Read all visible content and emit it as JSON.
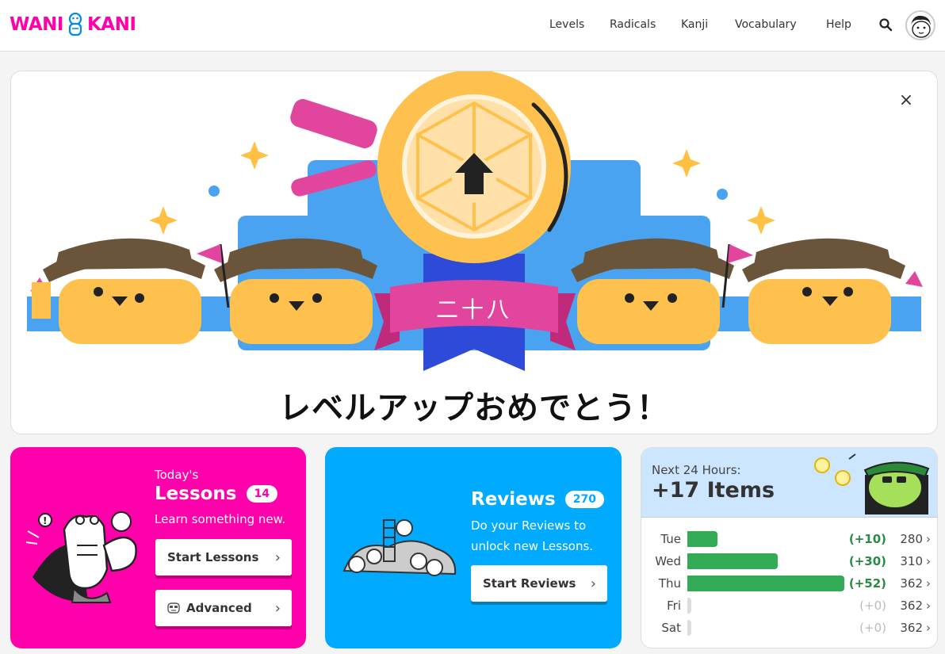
{
  "header": {
    "logo_left": "WANI",
    "logo_right": "KANI",
    "nav": [
      "Levels",
      "Radicals",
      "Kanji",
      "Vocabulary",
      "Help"
    ]
  },
  "celebration": {
    "level_kanji": "二十八",
    "message": "レベルアップおめでとう！",
    "close": "×"
  },
  "lessons": {
    "kicker": "Today's",
    "title": "Lessons",
    "count": "14",
    "subtitle": "Learn something new.",
    "start_button": "Start Lessons",
    "advanced_button": "Advanced"
  },
  "reviews": {
    "title": "Reviews",
    "count": "270",
    "subtitle": "Do your Reviews to unlock new Lessons.",
    "start_button": "Start Reviews"
  },
  "forecast": {
    "kicker": "Next 24 Hours:",
    "headline": "+17 Items",
    "rows": [
      {
        "day": "Tue",
        "plus": "(+10)",
        "total": "280",
        "value": 10
      },
      {
        "day": "Wed",
        "plus": "(+30)",
        "total": "310",
        "value": 30
      },
      {
        "day": "Thu",
        "plus": "(+52)",
        "total": "362",
        "value": 52
      },
      {
        "day": "Fri",
        "plus": "(+0)",
        "total": "362",
        "value": 0
      },
      {
        "day": "Sat",
        "plus": "(+0)",
        "total": "362",
        "value": 0
      }
    ]
  },
  "colors": {
    "brand_pink": "#ff00aa",
    "brand_blue": "#00aaff",
    "forecast_bar": "#33aa55"
  }
}
